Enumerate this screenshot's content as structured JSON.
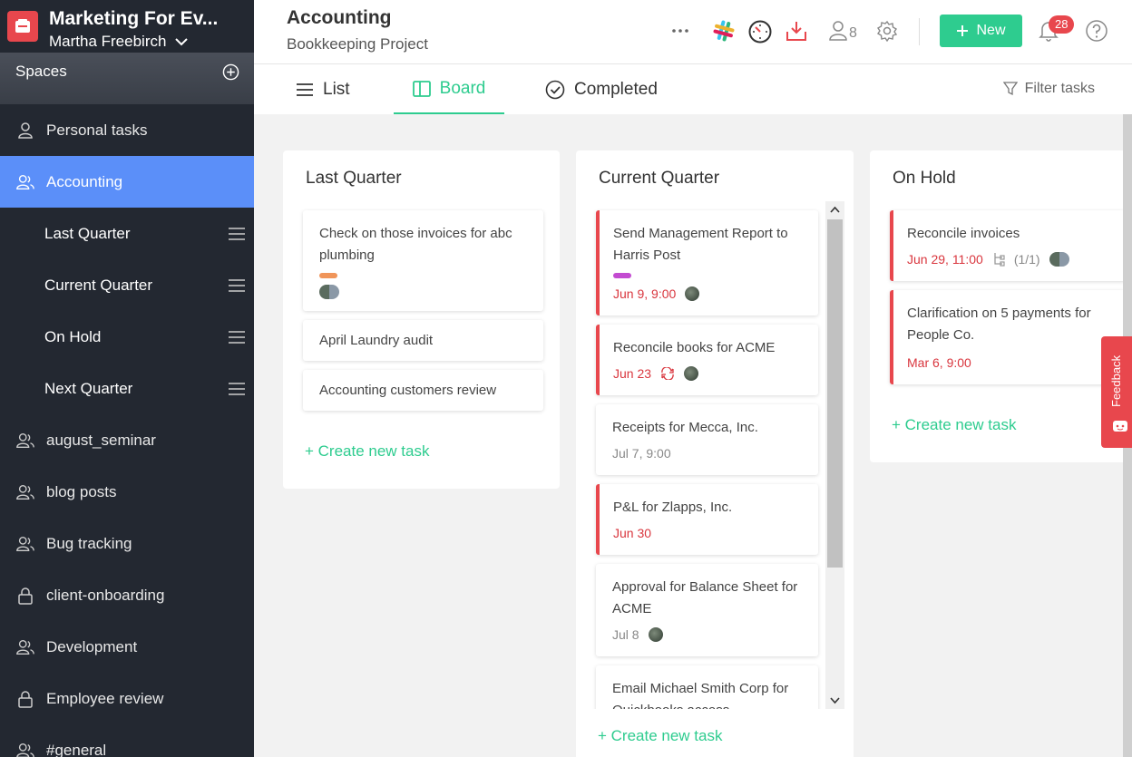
{
  "sidebar": {
    "org_name": "Marketing For Ev...",
    "user_name": "Martha Freebirch",
    "spaces_label": "Spaces",
    "items_top": [
      {
        "label": "Personal tasks",
        "icon": "user-icon"
      },
      {
        "label": "Accounting",
        "icon": "group-icon"
      }
    ],
    "subitems": [
      {
        "label": "Last Quarter"
      },
      {
        "label": "Current Quarter"
      },
      {
        "label": "On Hold"
      },
      {
        "label": "Next Quarter"
      }
    ],
    "items_bottom": [
      {
        "label": "august_seminar",
        "icon": "group-icon"
      },
      {
        "label": "blog posts",
        "icon": "group-icon"
      },
      {
        "label": "Bug tracking",
        "icon": "group-icon"
      },
      {
        "label": "client-onboarding",
        "icon": "lock-icon"
      },
      {
        "label": "Development",
        "icon": "group-icon"
      },
      {
        "label": "Employee review",
        "icon": "lock-icon"
      },
      {
        "label": "#general",
        "icon": "group-icon"
      }
    ]
  },
  "header": {
    "title": "Accounting",
    "subtitle": "Bookkeeping Project",
    "members_count": "8",
    "new_label": "New",
    "notif_count": "28"
  },
  "tabs": [
    {
      "label": "List",
      "icon": "list-icon"
    },
    {
      "label": "Board",
      "icon": "board-icon"
    },
    {
      "label": "Completed",
      "icon": "check-circle-icon"
    }
  ],
  "filter_label": "Filter tasks",
  "columns": [
    {
      "title": "Last Quarter",
      "create": "+ Create new task",
      "cards": [
        {
          "title": "Check on those invoices  for abc plumbing",
          "tag_color": "#f0955a"
        },
        {
          "title": "April Laundry audit"
        },
        {
          "title": "Accounting customers review"
        }
      ]
    },
    {
      "title": "Current Quarter",
      "create": "+ Create new task",
      "cards": [
        {
          "title": "Send Management Report to Harris Post",
          "due": "Jun 9, 9:00",
          "tag_color": "#c34bd1"
        },
        {
          "title": "Reconcile books for ACME",
          "due": "Jun 23"
        },
        {
          "title": "Receipts for Mecca, Inc.",
          "due": "Jul 7, 9:00"
        },
        {
          "title": "P&L for Zlapps, Inc.",
          "due": "Jun 30"
        },
        {
          "title": "Approval for Balance Sheet for ACME",
          "due": "Jul 8"
        },
        {
          "title": "Email Michael Smith Corp for Quickbooks access"
        }
      ]
    },
    {
      "title": "On Hold",
      "create": "+ Create new task",
      "cards": [
        {
          "title": "Reconcile invoices",
          "due": "Jun 29, 11:00",
          "subtasks": "(1/1)"
        },
        {
          "title": "Clarification on 5 payments for People Co.",
          "due": "Mar 6, 9:00"
        }
      ]
    }
  ],
  "feedback_label": "Feedback"
}
